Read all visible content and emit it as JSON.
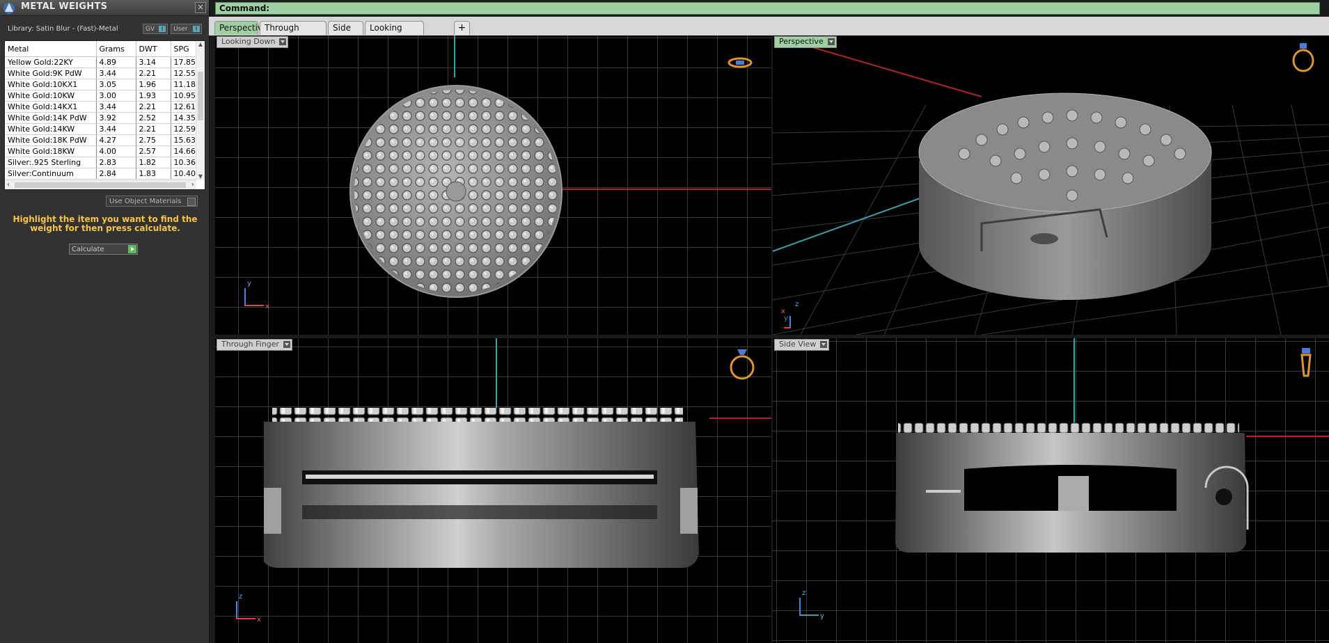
{
  "panel": {
    "title": "METAL WEIGHTS",
    "close_label": "×",
    "library_label": "Library: Satin Blur - (Fast)-Metal",
    "gv_label": "GV",
    "user_label": "User",
    "toggle_marker": "I",
    "use_object_materials_label": "Use Object Materials",
    "hint": "Highlight the item you want to find the weight for then press calculate.",
    "calculate_label": "Calculate",
    "accent_color": "#f5c542"
  },
  "metal_table": {
    "columns": [
      "Metal",
      "Grams",
      "DWT",
      "SPG"
    ],
    "rows": [
      [
        "Yellow Gold:22KY",
        "4.89",
        "3.14",
        "17.85"
      ],
      [
        "White Gold:9K PdW",
        "3.44",
        "2.21",
        "12.55"
      ],
      [
        "White Gold:10KX1",
        "3.05",
        "1.96",
        "11.18"
      ],
      [
        "White Gold:10KW",
        "3.00",
        "1.93",
        "10.95"
      ],
      [
        "White Gold:14KX1",
        "3.44",
        "2.21",
        "12.61"
      ],
      [
        "White Gold:14K PdW",
        "3.92",
        "2.52",
        "14.35"
      ],
      [
        "White Gold:14KW",
        "3.44",
        "2.21",
        "12.59"
      ],
      [
        "White Gold:18K PdW",
        "4.27",
        "2.75",
        "15.63"
      ],
      [
        "White Gold:18KW",
        "4.00",
        "2.57",
        "14.66"
      ],
      [
        "Silver:.925 Sterling",
        "2.83",
        "1.82",
        "10.36"
      ],
      [
        "Silver:Continuum",
        "2.84",
        "1.83",
        "10.40"
      ]
    ]
  },
  "command": {
    "label": "Command:"
  },
  "tabs": [
    "Perspective",
    "Through Finger",
    "Side View",
    "Looking Down"
  ],
  "viewports": {
    "top": {
      "label": "Looking Down"
    },
    "perspective": {
      "label": "Perspective"
    },
    "front": {
      "label": "Through Finger"
    },
    "side": {
      "label": "Side View"
    }
  },
  "axes": {
    "x": "x",
    "y": "y",
    "z": "z"
  }
}
